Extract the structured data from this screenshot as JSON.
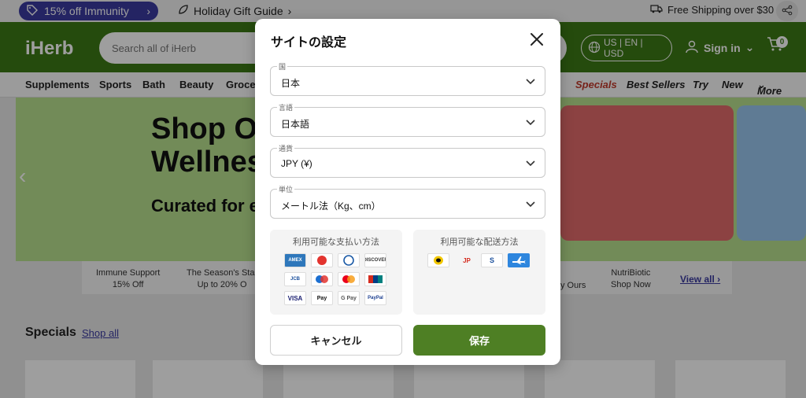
{
  "promo": {
    "pill_label": "15% off Immunity",
    "gift_guide": "Holiday Gift Guide",
    "free_shipping": "Free Shipping over $30"
  },
  "header": {
    "logo": "iHerb",
    "search_placeholder": "Search all of iHerb",
    "locale": "US | EN | USD",
    "sign_in": "Sign in",
    "cart_count": "0"
  },
  "nav": {
    "items": [
      "Supplements",
      "Sports",
      "Bath",
      "Beauty",
      "Grocer"
    ],
    "specials": "Specials",
    "best_sellers": "Best Sellers",
    "try": "Try",
    "new": "New",
    "more": "More"
  },
  "hero": {
    "title_line1": "Shop O",
    "title_line2": "Wellnes",
    "subtitle": "Curated for e"
  },
  "sub_links": {
    "immune_line1": "Immune Support",
    "immune_line2": "15% Off",
    "season_line1": "The Season's Star",
    "season_line2": "Up to 20% O",
    "ours": "y Ours",
    "nutri_line1": "NutriBiotic",
    "nutri_line2": "Shop Now",
    "view_all": "View all"
  },
  "specials": {
    "title": "Specials",
    "shop_all": "Shop all"
  },
  "modal": {
    "title": "サイトの設定",
    "country": {
      "label": "国",
      "value": "日本"
    },
    "language": {
      "label": "言語",
      "value": "日本語"
    },
    "currency": {
      "label": "通貨",
      "value": "JPY (¥)"
    },
    "units": {
      "label": "単位",
      "value": "メートル法（Kg、cm）"
    },
    "payment_title": "利用可能な支払い方法",
    "payment_methods": [
      "AMEX",
      "",
      "",
      "DISCOVER",
      "JCB",
      "",
      "",
      "",
      "VISA",
      "Pay",
      "G Pay",
      "PayPal"
    ],
    "shipping_title": "利用可能な配送方法",
    "shipping_methods": [
      "",
      "JP",
      "S",
      ""
    ],
    "cancel": "キャンセル",
    "save": "保存"
  },
  "colors": {
    "brand_green": "#3d7a16",
    "save_green": "#4e7f24",
    "promo_purple": "#3a3aa0"
  }
}
